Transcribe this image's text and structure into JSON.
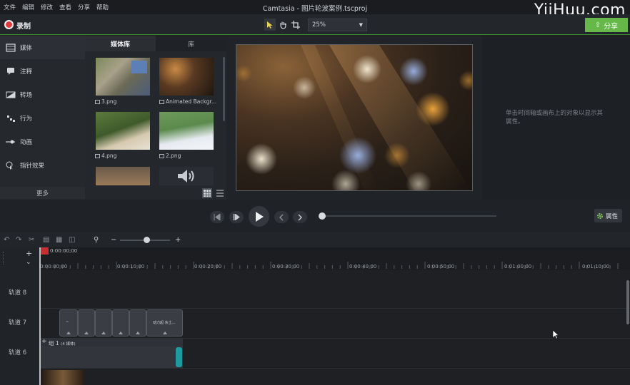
{
  "menu": [
    "文件",
    "编辑",
    "修改",
    "查看",
    "分享",
    "帮助"
  ],
  "window_title": "Camtasia - 图片轮波案例.tscproj",
  "watermark": "YiiHuu.com",
  "toolbar": {
    "record_label": "录制",
    "zoom_value": "25%",
    "share_label": "分享"
  },
  "sidebar": {
    "items": [
      {
        "label": "媒体",
        "icon": "film-icon"
      },
      {
        "label": "注释",
        "icon": "annotation-icon"
      },
      {
        "label": "转场",
        "icon": "transition-icon"
      },
      {
        "label": "行为",
        "icon": "behavior-icon"
      },
      {
        "label": "动画",
        "icon": "animation-icon"
      },
      {
        "label": "指针效果",
        "icon": "cursor-effect-icon"
      }
    ],
    "more_label": "更多",
    "add_label": "+"
  },
  "media": {
    "tabs": [
      "媒体库",
      "库"
    ],
    "items": [
      {
        "label": "3.png"
      },
      {
        "label": "Animated Backgr..."
      },
      {
        "label": "4.png"
      },
      {
        "label": "2.png"
      }
    ]
  },
  "properties": {
    "hint": "单击时间轴或画布上的对象以显示其属性。",
    "button_label": "属性"
  },
  "timeline": {
    "playhead_time": "0:00:00;00",
    "ruler": [
      "0:00:00;00",
      "0:00:10;00",
      "0:00:20;00",
      "0:00:30;00",
      "0:00:40;00",
      "0:00:50;00",
      "0:01:00;00",
      "0:01:10;00"
    ],
    "tracks": [
      "轨道 8",
      "轨道 7",
      "轨道 6"
    ],
    "group_label": "组 1",
    "group_count": "(4 媒体)",
    "last_clip_label": "动力起·东土..."
  },
  "colors": {
    "accent_green": "#66b848",
    "record_red": "#e23a3a",
    "handle_teal": "#1e9aa0"
  }
}
